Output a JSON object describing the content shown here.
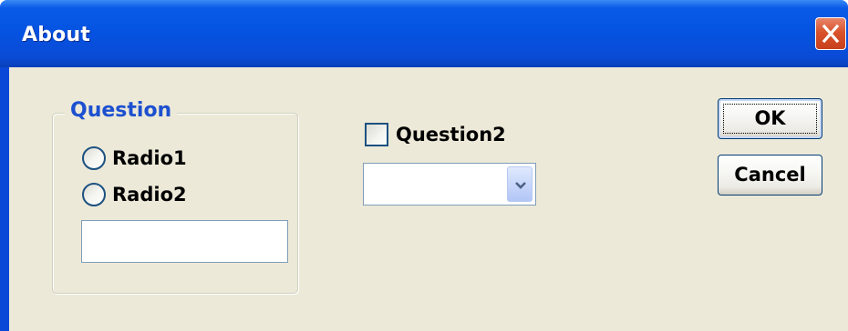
{
  "window": {
    "title": "About"
  },
  "group": {
    "label": "Question",
    "radios": [
      {
        "label": "Radio1",
        "selected": false
      },
      {
        "label": "Radio2",
        "selected": false
      }
    ],
    "text_value": ""
  },
  "checkbox": {
    "label": "Question2",
    "checked": false
  },
  "combo": {
    "value": ""
  },
  "buttons": {
    "ok": "OK",
    "cancel": "Cancel"
  },
  "colors": {
    "title_bar": "#0552e0",
    "close_button": "#d8532c",
    "dialog_background": "#ece9d8",
    "group_label": "#1d50d0",
    "control_border": "#7f9db9",
    "button_border": "#003c74"
  },
  "icons": {
    "close": "close-icon",
    "dropdown": "chevron-down-icon"
  }
}
